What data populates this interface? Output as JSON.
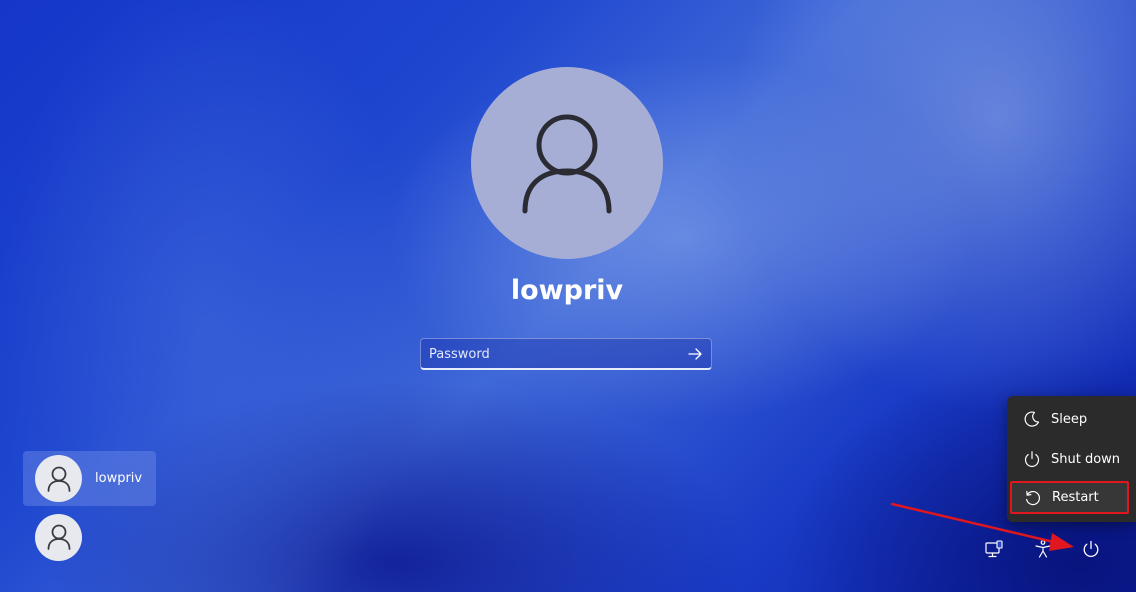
{
  "login": {
    "username": "lowpriv",
    "password_placeholder": "Password",
    "password_value": ""
  },
  "users": [
    {
      "name": "lowpriv",
      "selected": true
    },
    {
      "name": "",
      "selected": false
    }
  ],
  "power_menu": {
    "items": [
      {
        "label": "Sleep",
        "icon": "moon-icon"
      },
      {
        "label": "Shut down",
        "icon": "power-icon"
      },
      {
        "label": "Restart",
        "icon": "restart-icon",
        "highlighted": true
      }
    ]
  },
  "tray": {
    "icons": [
      "network-icon",
      "accessibility-icon",
      "power-icon"
    ]
  },
  "colors": {
    "annotation": "#e0171f",
    "menu_bg": "#2b2b2b",
    "avatar_bg": "#a6aed6"
  }
}
